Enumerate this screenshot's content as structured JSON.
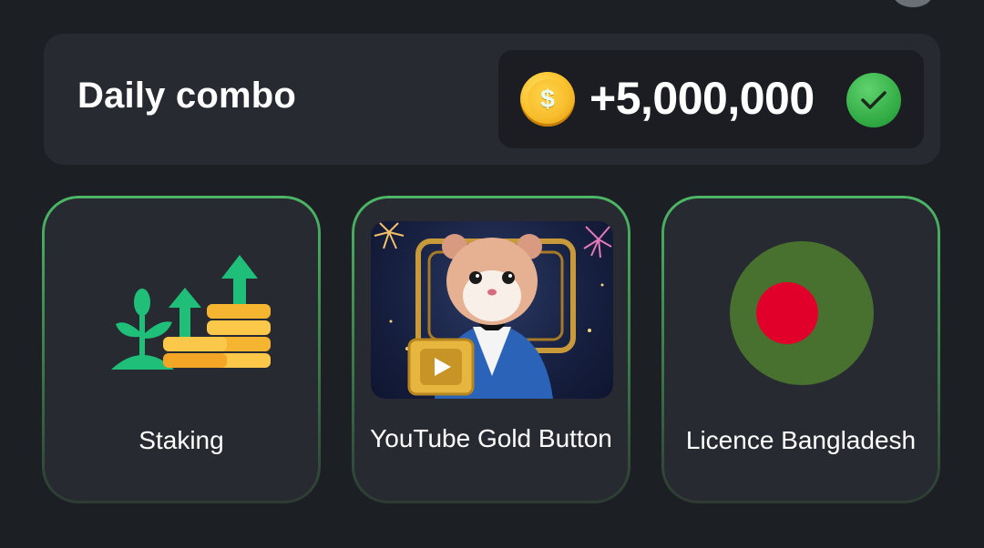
{
  "daily_combo": {
    "title": "Daily combo",
    "reward": "+5,000,000",
    "coin_symbol": "$",
    "completed": true
  },
  "cards": [
    {
      "label": "Staking",
      "icon": "staking-growth-icon"
    },
    {
      "label": "YouTube Gold Button",
      "icon": "hamster-gold-play-button-image"
    },
    {
      "label": "Licence Bangladesh",
      "icon": "bangladesh-flag-icon"
    }
  ],
  "colors": {
    "background": "#1c1f24",
    "panel": "#272a30",
    "card_border": "#4cb866",
    "check": "#2fa842",
    "coin": "#fbc531"
  }
}
